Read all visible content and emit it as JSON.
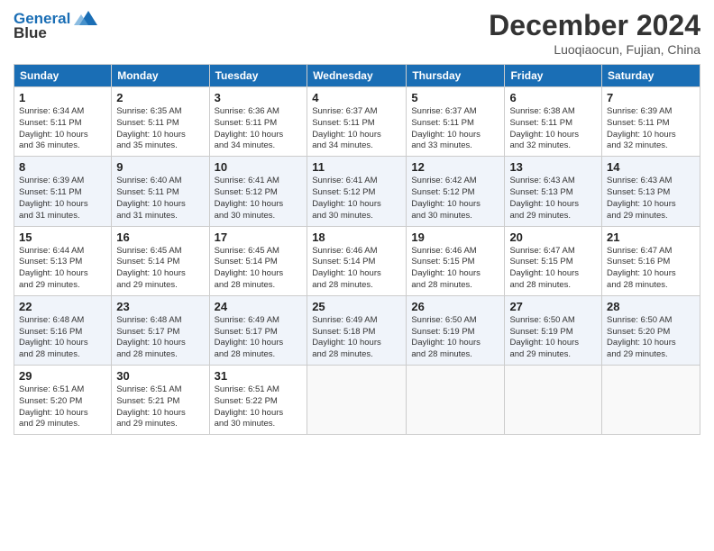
{
  "logo": {
    "line1": "General",
    "line2": "Blue"
  },
  "title": "December 2024",
  "location": "Luoqiaocun, Fujian, China",
  "weekdays": [
    "Sunday",
    "Monday",
    "Tuesday",
    "Wednesday",
    "Thursday",
    "Friday",
    "Saturday"
  ],
  "weeks": [
    [
      {
        "day": "1",
        "info": "Sunrise: 6:34 AM\nSunset: 5:11 PM\nDaylight: 10 hours\nand 36 minutes."
      },
      {
        "day": "2",
        "info": "Sunrise: 6:35 AM\nSunset: 5:11 PM\nDaylight: 10 hours\nand 35 minutes."
      },
      {
        "day": "3",
        "info": "Sunrise: 6:36 AM\nSunset: 5:11 PM\nDaylight: 10 hours\nand 34 minutes."
      },
      {
        "day": "4",
        "info": "Sunrise: 6:37 AM\nSunset: 5:11 PM\nDaylight: 10 hours\nand 34 minutes."
      },
      {
        "day": "5",
        "info": "Sunrise: 6:37 AM\nSunset: 5:11 PM\nDaylight: 10 hours\nand 33 minutes."
      },
      {
        "day": "6",
        "info": "Sunrise: 6:38 AM\nSunset: 5:11 PM\nDaylight: 10 hours\nand 32 minutes."
      },
      {
        "day": "7",
        "info": "Sunrise: 6:39 AM\nSunset: 5:11 PM\nDaylight: 10 hours\nand 32 minutes."
      }
    ],
    [
      {
        "day": "8",
        "info": "Sunrise: 6:39 AM\nSunset: 5:11 PM\nDaylight: 10 hours\nand 31 minutes."
      },
      {
        "day": "9",
        "info": "Sunrise: 6:40 AM\nSunset: 5:11 PM\nDaylight: 10 hours\nand 31 minutes."
      },
      {
        "day": "10",
        "info": "Sunrise: 6:41 AM\nSunset: 5:12 PM\nDaylight: 10 hours\nand 30 minutes."
      },
      {
        "day": "11",
        "info": "Sunrise: 6:41 AM\nSunset: 5:12 PM\nDaylight: 10 hours\nand 30 minutes."
      },
      {
        "day": "12",
        "info": "Sunrise: 6:42 AM\nSunset: 5:12 PM\nDaylight: 10 hours\nand 30 minutes."
      },
      {
        "day": "13",
        "info": "Sunrise: 6:43 AM\nSunset: 5:13 PM\nDaylight: 10 hours\nand 29 minutes."
      },
      {
        "day": "14",
        "info": "Sunrise: 6:43 AM\nSunset: 5:13 PM\nDaylight: 10 hours\nand 29 minutes."
      }
    ],
    [
      {
        "day": "15",
        "info": "Sunrise: 6:44 AM\nSunset: 5:13 PM\nDaylight: 10 hours\nand 29 minutes."
      },
      {
        "day": "16",
        "info": "Sunrise: 6:45 AM\nSunset: 5:14 PM\nDaylight: 10 hours\nand 29 minutes."
      },
      {
        "day": "17",
        "info": "Sunrise: 6:45 AM\nSunset: 5:14 PM\nDaylight: 10 hours\nand 28 minutes."
      },
      {
        "day": "18",
        "info": "Sunrise: 6:46 AM\nSunset: 5:14 PM\nDaylight: 10 hours\nand 28 minutes."
      },
      {
        "day": "19",
        "info": "Sunrise: 6:46 AM\nSunset: 5:15 PM\nDaylight: 10 hours\nand 28 minutes."
      },
      {
        "day": "20",
        "info": "Sunrise: 6:47 AM\nSunset: 5:15 PM\nDaylight: 10 hours\nand 28 minutes."
      },
      {
        "day": "21",
        "info": "Sunrise: 6:47 AM\nSunset: 5:16 PM\nDaylight: 10 hours\nand 28 minutes."
      }
    ],
    [
      {
        "day": "22",
        "info": "Sunrise: 6:48 AM\nSunset: 5:16 PM\nDaylight: 10 hours\nand 28 minutes."
      },
      {
        "day": "23",
        "info": "Sunrise: 6:48 AM\nSunset: 5:17 PM\nDaylight: 10 hours\nand 28 minutes."
      },
      {
        "day": "24",
        "info": "Sunrise: 6:49 AM\nSunset: 5:17 PM\nDaylight: 10 hours\nand 28 minutes."
      },
      {
        "day": "25",
        "info": "Sunrise: 6:49 AM\nSunset: 5:18 PM\nDaylight: 10 hours\nand 28 minutes."
      },
      {
        "day": "26",
        "info": "Sunrise: 6:50 AM\nSunset: 5:19 PM\nDaylight: 10 hours\nand 28 minutes."
      },
      {
        "day": "27",
        "info": "Sunrise: 6:50 AM\nSunset: 5:19 PM\nDaylight: 10 hours\nand 29 minutes."
      },
      {
        "day": "28",
        "info": "Sunrise: 6:50 AM\nSunset: 5:20 PM\nDaylight: 10 hours\nand 29 minutes."
      }
    ],
    [
      {
        "day": "29",
        "info": "Sunrise: 6:51 AM\nSunset: 5:20 PM\nDaylight: 10 hours\nand 29 minutes."
      },
      {
        "day": "30",
        "info": "Sunrise: 6:51 AM\nSunset: 5:21 PM\nDaylight: 10 hours\nand 29 minutes."
      },
      {
        "day": "31",
        "info": "Sunrise: 6:51 AM\nSunset: 5:22 PM\nDaylight: 10 hours\nand 30 minutes."
      },
      {
        "day": "",
        "info": ""
      },
      {
        "day": "",
        "info": ""
      },
      {
        "day": "",
        "info": ""
      },
      {
        "day": "",
        "info": ""
      }
    ]
  ]
}
